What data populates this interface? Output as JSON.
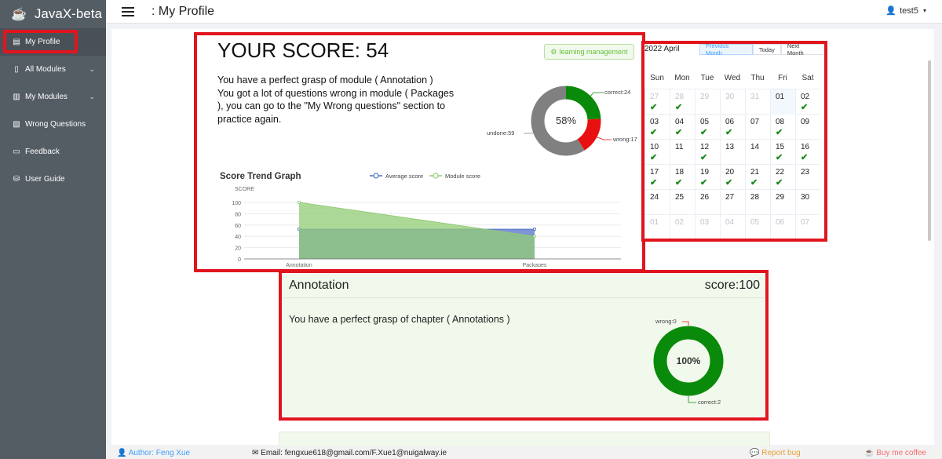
{
  "app": {
    "title": "JavaX-beta"
  },
  "sidebar": {
    "items": [
      {
        "label": "My Profile"
      },
      {
        "label": "All Modules"
      },
      {
        "label": "My Modules"
      },
      {
        "label": "Wrong Questions"
      },
      {
        "label": "Feedback"
      },
      {
        "label": "User Guide"
      }
    ]
  },
  "header": {
    "title": ": My Profile",
    "user": "test5"
  },
  "score_card": {
    "title": "YOUR SCORE:  54",
    "lines": [
      "You have a perfect grasp of module ( Annotation )",
      "You got a lot of questions wrong in module ( Packages",
      "), you can go to the \"My Wrong questions\" section to",
      "practice again."
    ],
    "button_label": "learning management",
    "donut": {
      "center": "58%",
      "correct_label": "correct:24",
      "wrong_label": "wrong:17",
      "undone_label": "undone:59",
      "correct": 24,
      "wrong": 17,
      "undone": 59,
      "colors": {
        "correct": "#0a8a0a",
        "wrong": "#e81010",
        "undone": "#808080"
      }
    }
  },
  "chart_data": {
    "type": "area",
    "title": "Score Trend Graph",
    "ylabel": "SCORE",
    "categories": [
      "Annotation",
      "Packages"
    ],
    "yticks": [
      "0",
      "20",
      "40",
      "60",
      "80",
      "100"
    ],
    "ylim": [
      0,
      100
    ],
    "legend_position": "top",
    "series": [
      {
        "name": "Average score",
        "values": [
          52.6,
          52.6
        ],
        "color": "#5470c6"
      },
      {
        "name": "Module score",
        "values": [
          100,
          40
        ],
        "color": "#91cc75"
      }
    ]
  },
  "calendar": {
    "month": "2022 April",
    "buttons": [
      "Previous Month",
      "Today",
      "Next Month"
    ],
    "weekdays": [
      "Sun",
      "Mon",
      "Tue",
      "Wed",
      "Thu",
      "Fri",
      "Sat"
    ],
    "weeks": [
      [
        {
          "d": "27",
          "o": true,
          "c": true
        },
        {
          "d": "28",
          "o": true,
          "c": true
        },
        {
          "d": "29",
          "o": true
        },
        {
          "d": "30",
          "o": true
        },
        {
          "d": "31",
          "o": true
        },
        {
          "d": "01",
          "t": true
        },
        {
          "d": "02",
          "c": true
        }
      ],
      [
        {
          "d": "03",
          "c": true
        },
        {
          "d": "04",
          "c": true
        },
        {
          "d": "05",
          "c": true
        },
        {
          "d": "06",
          "c": true
        },
        {
          "d": "07"
        },
        {
          "d": "08",
          "c": true
        },
        {
          "d": "09"
        }
      ],
      [
        {
          "d": "10",
          "c": true
        },
        {
          "d": "11"
        },
        {
          "d": "12",
          "c": true
        },
        {
          "d": "13"
        },
        {
          "d": "14"
        },
        {
          "d": "15",
          "c": true
        },
        {
          "d": "16",
          "c": true
        }
      ],
      [
        {
          "d": "17",
          "c": true
        },
        {
          "d": "18",
          "c": true
        },
        {
          "d": "19",
          "c": true
        },
        {
          "d": "20",
          "c": true
        },
        {
          "d": "21",
          "c": true
        },
        {
          "d": "22",
          "c": true
        },
        {
          "d": "23"
        }
      ],
      [
        {
          "d": "24"
        },
        {
          "d": "25"
        },
        {
          "d": "26"
        },
        {
          "d": "27"
        },
        {
          "d": "28"
        },
        {
          "d": "29"
        },
        {
          "d": "30"
        }
      ],
      [
        {
          "d": "01",
          "o": true
        },
        {
          "d": "02",
          "o": true
        },
        {
          "d": "03",
          "o": true
        },
        {
          "d": "04",
          "o": true
        },
        {
          "d": "05",
          "o": true
        },
        {
          "d": "06",
          "o": true
        },
        {
          "d": "07",
          "o": true
        }
      ]
    ]
  },
  "module_card": {
    "title": "Annotation",
    "score": "score:100",
    "desc": "You have a perfect grasp of chapter ( Annotations )",
    "donut": {
      "center": "100%",
      "wrong_label": "wrong:0",
      "correct_label": "correct:2",
      "color": "#0a8a0a"
    }
  },
  "footer": {
    "author": "Author: Feng Xue",
    "email": "Email: fengxue618@gmail.com/F.Xue1@nuigalway.ie",
    "bug": "Report bug",
    "coffee": "Buy me coffee"
  }
}
